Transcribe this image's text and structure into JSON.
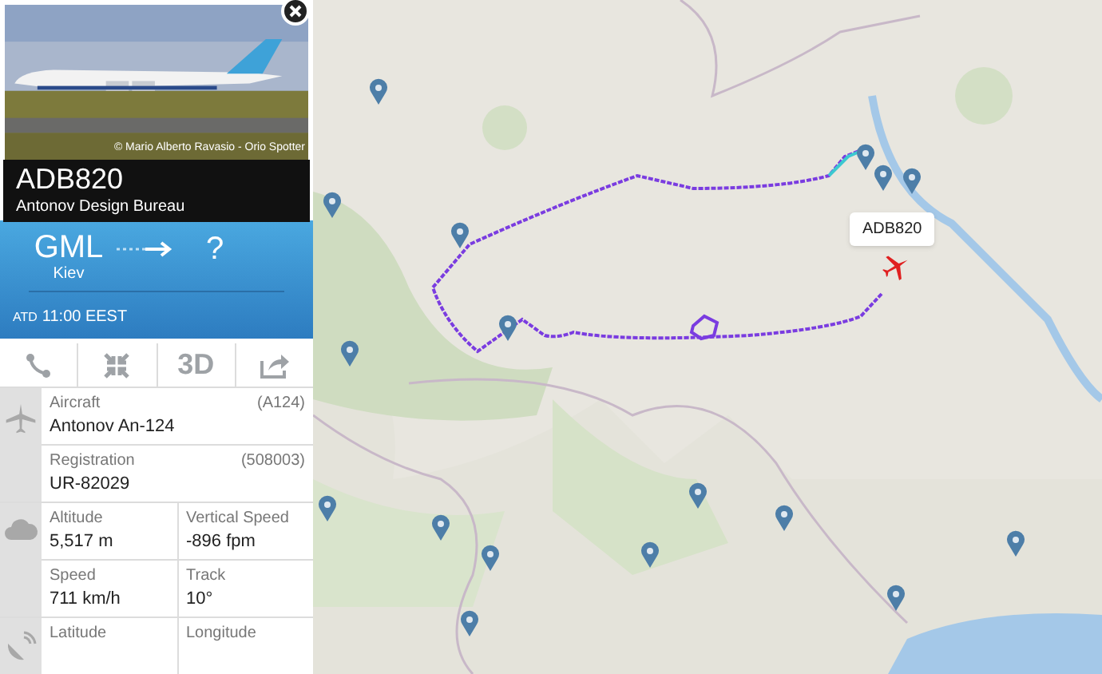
{
  "photo": {
    "kind": "picture",
    "credit": "© Mario Alberto Ravasio - Orio Spotter"
  },
  "flight": {
    "callsign": "ADB820",
    "airline": "Antonov Design Bureau"
  },
  "route": {
    "origin_code": "GML",
    "origin_city": "Kiev",
    "destination_code": "?",
    "atd_label": "ATD",
    "atd_time": "11:00 EEST"
  },
  "actions": [
    {
      "kind": "route"
    },
    {
      "kind": "collapse"
    },
    {
      "kind": "text",
      "label": "3D"
    },
    {
      "kind": "share"
    }
  ],
  "details": [
    {
      "kind": "plane",
      "rows": [
        [
          {
            "label": "Aircraft",
            "value": "Antonov An-124",
            "extra": "(A124)"
          }
        ],
        [
          {
            "label": "Registration",
            "value": "UR-82029",
            "extra": "(508003)"
          }
        ]
      ]
    },
    {
      "kind": "cloud",
      "rows": [
        [
          {
            "label": "Altitude",
            "value": "5,517 m"
          },
          {
            "label": "Vertical Speed",
            "value": "-896 fpm"
          }
        ],
        [
          {
            "label": "Speed",
            "value": "711 km/h"
          },
          {
            "label": "Track",
            "value": "10°"
          }
        ]
      ]
    },
    {
      "kind": "satellite",
      "rows": [
        [
          {
            "label": "Latitude"
          },
          {
            "label": "Longitude"
          }
        ]
      ]
    }
  ],
  "map": {
    "flight_label": "ADB820"
  }
}
